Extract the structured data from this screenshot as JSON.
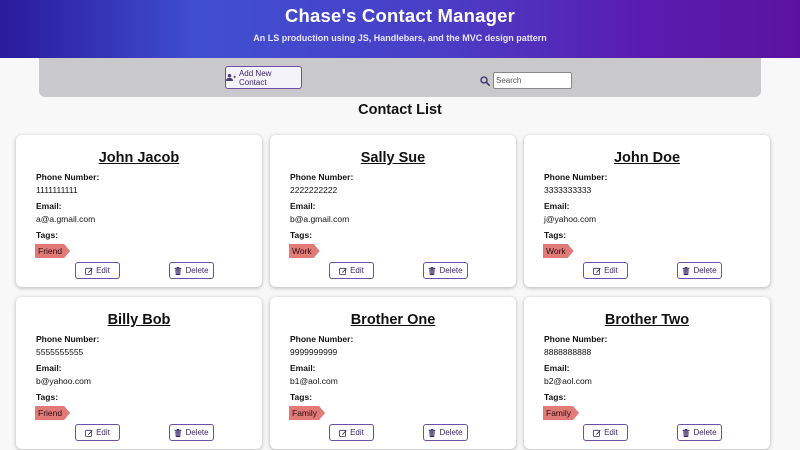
{
  "header": {
    "title": "Chase's Contact Manager",
    "subtitle": "An LS production using JS, Handlebars, and the MVC design pattern"
  },
  "toolbar": {
    "add_label": "Add New Contact",
    "search_placeholder": "Search"
  },
  "list_title": "Contact List",
  "labels": {
    "phone": "Phone Number:",
    "email": "Email:",
    "tags": "Tags:",
    "edit": "Edit",
    "delete": "Delete"
  },
  "contacts": [
    {
      "name": "John Jacob",
      "phone": "1111111111",
      "email": "a@a.gmail.com",
      "tag": "Friend"
    },
    {
      "name": "Sally Sue",
      "phone": "2222222222",
      "email": "b@a.gmail.com",
      "tag": "Work"
    },
    {
      "name": "John Doe",
      "phone": "3333333333",
      "email": "j@yahoo.com",
      "tag": "Work"
    },
    {
      "name": "Billy Bob",
      "phone": "5555555555",
      "email": "b@yahoo.com",
      "tag": "Friend"
    },
    {
      "name": "Brother One",
      "phone": "9999999999",
      "email": "b1@aol.com",
      "tag": "Family"
    },
    {
      "name": "Brother Two",
      "phone": "8888888888",
      "email": "b2@aol.com",
      "tag": "Family"
    }
  ],
  "icons": {
    "add": "user-plus-icon",
    "search": "search-icon",
    "edit": "edit-icon",
    "delete": "trash-icon"
  },
  "colors": {
    "header_start": "#2a1a9c",
    "header_end": "#5b139f",
    "accent": "#6b4fa8",
    "tag": "#e27a78",
    "toolbar": "#c9c9cc"
  }
}
